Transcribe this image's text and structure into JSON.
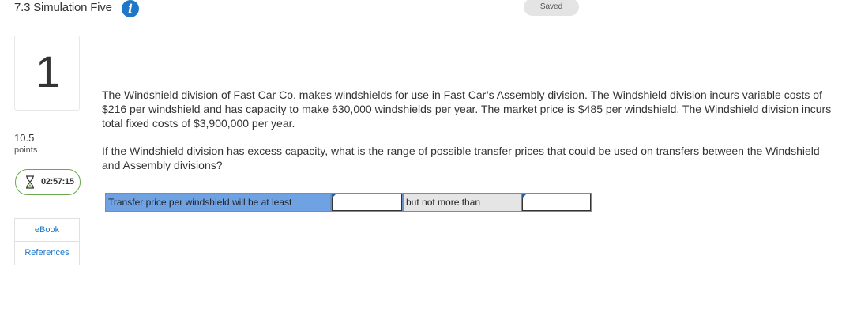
{
  "header": {
    "title": "7.3 Simulation Five",
    "info_icon": "info-icon",
    "saved_label": "Saved"
  },
  "sidebar": {
    "question_number": "1",
    "points_value": "10.5",
    "points_label": "points",
    "timer": "02:57:15",
    "ebook_label": "eBook",
    "references_label": "References"
  },
  "question": {
    "paragraph1": "The Windshield division of Fast Car Co. makes windshields for use in Fast Car’s Assembly division. The Windshield division incurs variable costs of $216 per windshield and has capacity to make 630,000 windshields per year. The market price is $485 per windshield. The Windshield division incurs total fixed costs of $3,900,000 per year.",
    "paragraph2": "If the Windshield division has excess capacity, what is the range of possible transfer prices that could be used on transfers between the Windshield and Assembly divisions?"
  },
  "answer": {
    "label_min": "Transfer price per windshield will be at least",
    "min_value": "",
    "label_max": "but not more than",
    "max_value": ""
  },
  "colors": {
    "accent": "#1f77c7",
    "timer_border": "#6aa84f",
    "label_blue": "#6fa2e3",
    "label_gray": "#e5e5e5"
  }
}
